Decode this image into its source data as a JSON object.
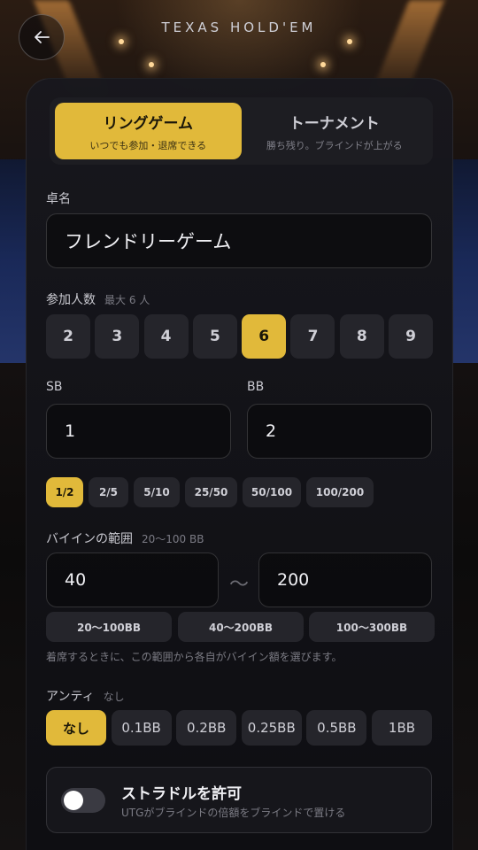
{
  "header": {
    "title": "TEXAS HOLD'EM",
    "back_icon": "arrow-left-icon"
  },
  "mode": {
    "tabs": [
      {
        "label": "リングゲーム",
        "desc": "いつでも参加・退席できる",
        "active": true
      },
      {
        "label": "トーナメント",
        "desc": "勝ち残り。ブラインドが上がる",
        "active": false
      }
    ]
  },
  "table_name": {
    "label": "卓名",
    "value": "フレンドリーゲーム"
  },
  "players": {
    "label": "参加人数",
    "sub": "最大 6 人",
    "options": [
      "2",
      "3",
      "4",
      "5",
      "6",
      "7",
      "8",
      "9"
    ],
    "selected": "6"
  },
  "blinds": {
    "sb_label": "SB",
    "sb_value": "1",
    "bb_label": "BB",
    "bb_value": "2",
    "presets": [
      "1/2",
      "2/5",
      "5/10",
      "25/50",
      "50/100",
      "100/200"
    ],
    "selected": "1/2"
  },
  "buyin": {
    "label": "バイインの範囲",
    "sub": "20〜100 BB",
    "min": "40",
    "max": "200",
    "separator": "〜",
    "presets": [
      "20〜100BB",
      "40〜200BB",
      "100〜300BB"
    ],
    "note": "着席するときに、この範囲から各自がバイイン額を選びます。"
  },
  "ante": {
    "label": "アンティ",
    "sub": "なし",
    "options": [
      "なし",
      "0.1BB",
      "0.2BB",
      "0.25BB",
      "0.5BB",
      "1BB"
    ],
    "selected": "なし"
  },
  "straddle": {
    "title": "ストラドルを許可",
    "desc": "UTGがブラインドの倍額をブラインドで置ける",
    "enabled": false
  },
  "colors": {
    "accent": "#e1b93a",
    "chip": "#25252b"
  }
}
